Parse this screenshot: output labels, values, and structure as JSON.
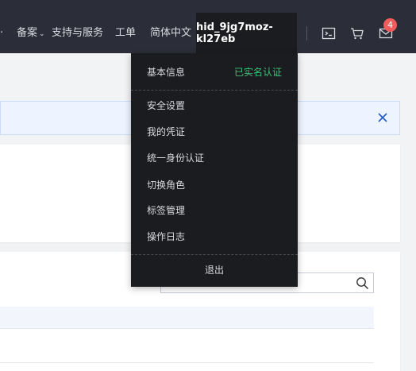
{
  "topnav": {
    "items": [
      {
        "label": "备案",
        "has_caret": true
      },
      {
        "label": "支持与服务"
      },
      {
        "label": "工单"
      },
      {
        "label": "简体中文"
      }
    ],
    "username": "hid_9jg7moz-kl27eb",
    "message_count": "4",
    "icons": [
      "terminal-icon",
      "cart-icon",
      "mail-icon"
    ]
  },
  "notice": {
    "close_icon": "close-icon"
  },
  "search": {
    "value": "",
    "placeholder": ""
  },
  "user_menu": {
    "basic_info": "基本信息",
    "verified_status": "已实名认证",
    "items": [
      "安全设置",
      "我的凭证",
      "统一身份认证",
      "切换角色",
      "标签管理",
      "操作日志"
    ],
    "logout": "退出"
  },
  "colors": {
    "topbar_bg": "#2b2e38",
    "menu_bg": "#1b1c1f",
    "verified_green": "#3bc47a",
    "badge_red": "#f25c5c",
    "notice_blue": "#1f5ac8"
  }
}
